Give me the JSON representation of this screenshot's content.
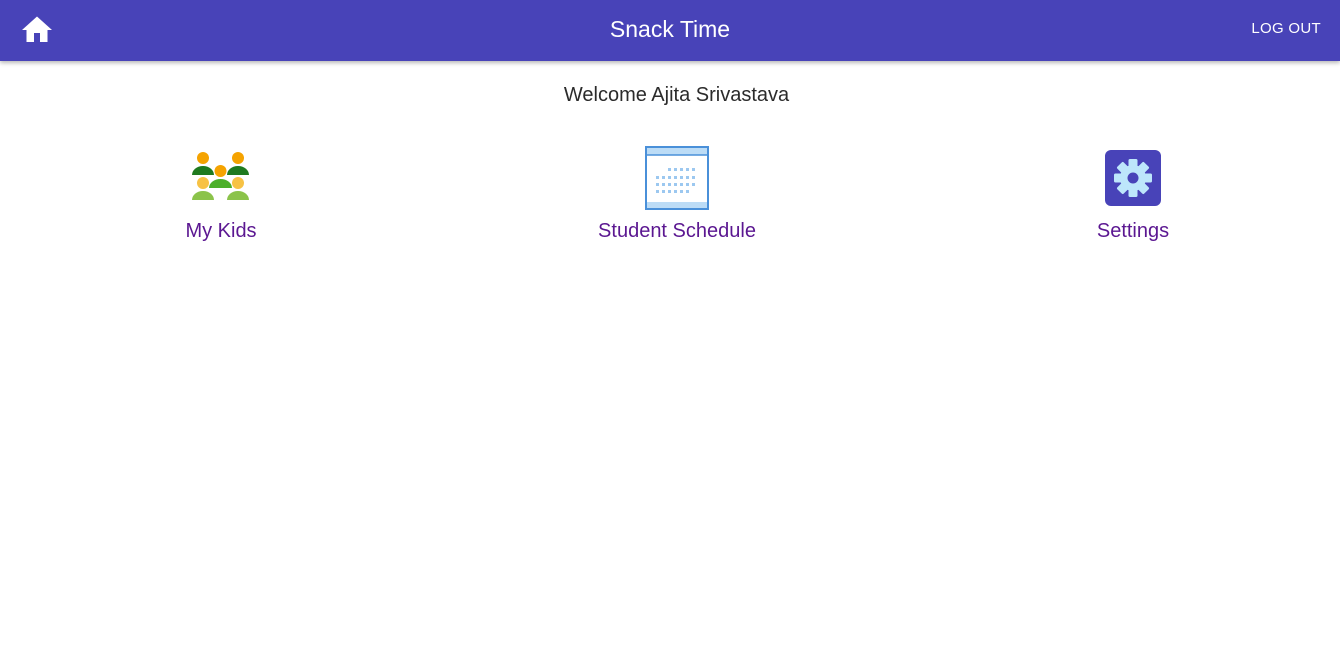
{
  "header": {
    "title": "Snack Time",
    "logout_label": "LOG OUT",
    "home_icon": "home-icon",
    "background": "#4843b8"
  },
  "welcome": {
    "text": "Welcome Ajita Srivastava"
  },
  "tiles": [
    {
      "label": "My Kids",
      "icon": "kids-group-icon"
    },
    {
      "label": "Student Schedule",
      "icon": "calendar-icon"
    },
    {
      "label": "Settings",
      "icon": "gear-icon"
    }
  ],
  "colors": {
    "accent": "#4843b8",
    "link_text": "#5b1791"
  }
}
